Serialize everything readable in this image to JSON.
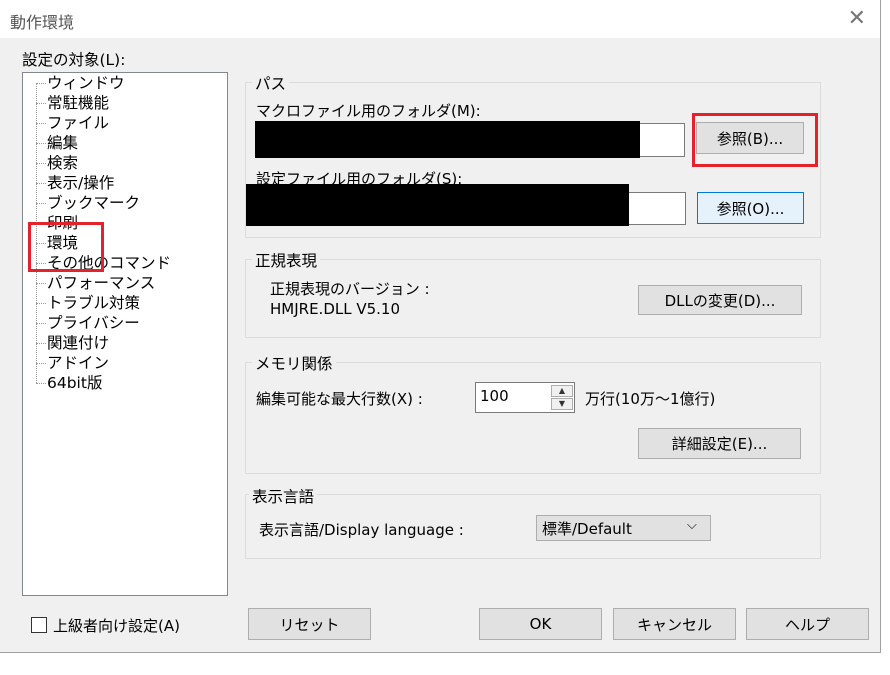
{
  "window": {
    "title": "動作環境",
    "close_glyph": "✕"
  },
  "sidebar": {
    "label": "設定の対象(L):",
    "items": [
      {
        "label": "ウィンドウ"
      },
      {
        "label": "常駐機能"
      },
      {
        "label": "ファイル"
      },
      {
        "label": "編集"
      },
      {
        "label": "検索"
      },
      {
        "label": "表示/操作"
      },
      {
        "label": "ブックマーク"
      },
      {
        "label": "印刷"
      },
      {
        "label": "環境"
      },
      {
        "label": "その他のコマンド"
      },
      {
        "label": "パフォーマンス"
      },
      {
        "label": "トラブル対策"
      },
      {
        "label": "プライバシー"
      },
      {
        "label": "関連付け"
      },
      {
        "label": "アドイン"
      },
      {
        "label": "64bit版"
      }
    ]
  },
  "path_group": {
    "title": "パス",
    "macro_label": "マクロファイル用のフォルダ(M):",
    "macro_browse": "参照(B)...",
    "settings_label": "設定ファイル用のフォルダ(S):",
    "settings_browse": "参照(O)..."
  },
  "regex_group": {
    "title": "正規表現",
    "version_label": "正規表現のバージョン :",
    "version_value": "HMJRE.DLL V5.10",
    "dll_button": "DLLの変更(D)..."
  },
  "memory_group": {
    "title": "メモリ関係",
    "max_lines_label": "編集可能な最大行数(X) :",
    "max_lines_value": "100",
    "unit_label": "万行(10万～1億行)",
    "detail_button": "詳細設定(E)..."
  },
  "language_group": {
    "title": "表示言語",
    "label": "表示言語/Display language :",
    "selected": "標準/Default"
  },
  "footer": {
    "advanced_checkbox": "上級者向け設定(A)",
    "reset": "リセット",
    "ok": "OK",
    "cancel": "キャンセル",
    "help": "ヘルプ"
  },
  "highlight_color": "#e5212b"
}
